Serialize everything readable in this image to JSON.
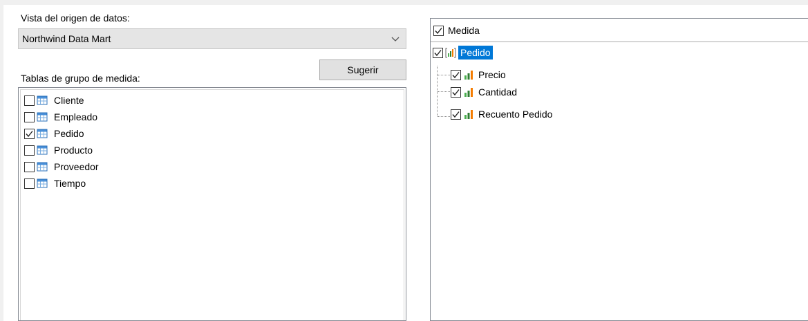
{
  "data_source": {
    "label": "Vista del origen de datos:",
    "selected": "Northwind Data Mart",
    "chevron_icon": "chevron-down-icon"
  },
  "measure_group_tables": {
    "label": "Tablas de grupo de medida:",
    "suggest_button": "Sugerir",
    "items": [
      {
        "label": "Cliente",
        "checked": false
      },
      {
        "label": "Empleado",
        "checked": false
      },
      {
        "label": "Pedido",
        "checked": true
      },
      {
        "label": "Producto",
        "checked": false
      },
      {
        "label": "Proveedor",
        "checked": false
      },
      {
        "label": "Tiempo",
        "checked": false
      }
    ]
  },
  "measures": {
    "header": "Medida",
    "header_checked": true,
    "group": {
      "label": "Pedido",
      "checked": true,
      "selected": true
    },
    "children": [
      {
        "label": "Precio",
        "checked": true
      },
      {
        "label": "Cantidad",
        "checked": true
      },
      {
        "label": "Recuento Pedido",
        "checked": true
      }
    ]
  },
  "colors": {
    "selection": "#0078d7",
    "dropdown_bg": "#e5e5e5",
    "button_bg": "#e1e1e1"
  }
}
